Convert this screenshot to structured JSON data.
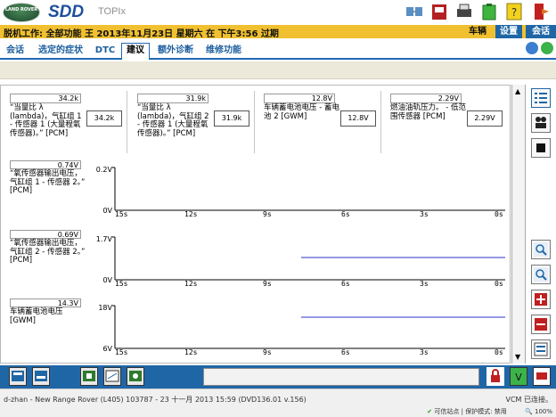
{
  "header": {
    "logo_text": "LAND ROVER",
    "app_name": "SDD",
    "app_suffix": "TOPIx",
    "icons": [
      "network-icon",
      "vci-device-icon",
      "printer-icon",
      "battery-icon",
      "help-icon",
      "exit-icon"
    ]
  },
  "status": {
    "title": "脱机工作: 全部功能 王 2013年11月23日 星期六 在 下午3:56 过期",
    "tabs": [
      {
        "label": "车辆",
        "active": true
      },
      {
        "label": "设置",
        "active": false
      },
      {
        "label": "会话",
        "active": false
      }
    ]
  },
  "menu": {
    "tabs": [
      "会话",
      "选定的症状",
      "DTC",
      "建议",
      "额外诊断",
      "维修功能"
    ],
    "selected": "建议"
  },
  "params": [
    {
      "top_value": "34.2k",
      "label": "“当量比 λ (lambda)，气缸组 1 - 传感器 1 (大量程氧传感器)。” [PCM]",
      "value": "34.2k"
    },
    {
      "top_value": "31.9k",
      "label": "“当量比 λ (lambda)，气缸组 2 - 传感器 1 (大量程氧传感器)。” [PCM]",
      "value": "31.9k"
    },
    {
      "top_value": "12.8V",
      "label": "车辆蓄电池电压 - 蓄电池 2 [GWM]",
      "value": "12.8V"
    },
    {
      "top_value": "2.29V",
      "label": "燃油油轨压力。 - 低范围传感器 [PCM]",
      "value": "2.29V"
    }
  ],
  "graphs": [
    {
      "top_value": "0.74V",
      "label": "“氧传感器输出电压，气缸组 1 - 传感器 2。” [PCM]",
      "ymax": "0.2V",
      "ymin": "0V",
      "has_trace": false
    },
    {
      "top_value": "0.69V",
      "label": "“氧传感器输出电压，气缸组 2 - 传感器 2。” [PCM]",
      "ymax": "1.7V",
      "ymin": "0V",
      "has_trace": true
    },
    {
      "top_value": "14.3V",
      "label": "车辆蓄电池电压 [GWM]",
      "ymax": "18V",
      "ymin": "6V",
      "has_trace": true
    }
  ],
  "x_ticks": [
    "15s",
    "12s",
    "9s",
    "6s",
    "3s",
    "0s"
  ],
  "bottom_icons": [
    "vehicle-info-icon",
    "config-icon",
    "module-icon",
    "datalogger-icon",
    "network-map-icon"
  ],
  "footer": {
    "vehicle_line": "d-zhan - New Range Rover (L405) 103787 - 23 十一月 2013 15:59 (DVD136.01 v.156)",
    "connection": "VCM 已连接。",
    "trusted_site": "可信站点 | 保护模式: 禁用",
    "zoom": "100%"
  },
  "colors": {
    "accent_blue": "#1f66a6",
    "status_yellow": "#f0c030",
    "trace_blue": "#2a34c8"
  }
}
